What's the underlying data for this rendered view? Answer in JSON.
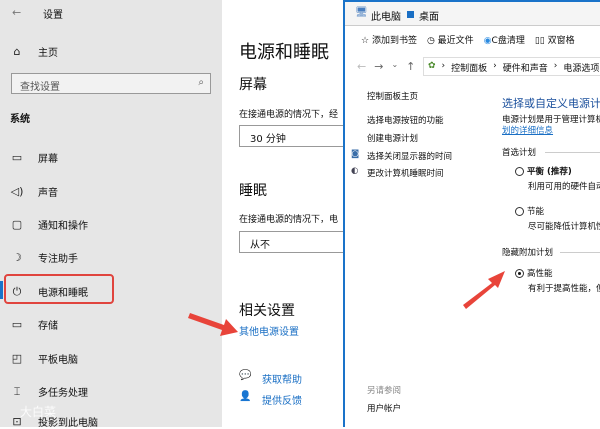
{
  "settings": {
    "title": "设置",
    "home": "主页",
    "search_placeholder": "查找设置",
    "section": "系统",
    "nav": [
      {
        "label": "屏幕",
        "icon": "monitor-icon"
      },
      {
        "label": "声音",
        "icon": "speaker-icon"
      },
      {
        "label": "通知和操作",
        "icon": "notification-icon"
      },
      {
        "label": "专注助手",
        "icon": "moon-icon"
      },
      {
        "label": "电源和睡眠",
        "icon": "power-icon"
      },
      {
        "label": "存储",
        "icon": "storage-icon"
      },
      {
        "label": "平板电脑",
        "icon": "tablet-icon"
      },
      {
        "label": "多任务处理",
        "icon": "multitask-icon"
      },
      {
        "label": "投影到此电脑",
        "icon": "project-icon"
      }
    ],
    "watermark": "大白菜"
  },
  "power": {
    "title": "电源和睡眠",
    "screen_heading": "屏幕",
    "screen_desc": "在接通电源的情况下，经",
    "screen_value": "30 分钟",
    "sleep_heading": "睡眠",
    "sleep_desc": "在接通电源的情况下，电",
    "sleep_value": "从不",
    "related_heading": "相关设置",
    "related_link": "其他电源设置",
    "help": "获取帮助",
    "feedback": "提供反馈"
  },
  "explorer": {
    "tabs": [
      "此电脑",
      "桌面"
    ],
    "bookmarks": [
      "添加到书签",
      "最近文件",
      "C盘清理",
      "双窗格"
    ],
    "breadcrumb": [
      "控制面板",
      "硬件和声音",
      "电源选项"
    ],
    "left_links": [
      "控制面板主页",
      "选择电源按钮的功能",
      "创建电源计划",
      "选择关闭显示器的时间",
      "更改计算机睡眠时间"
    ],
    "see_also": "另请参阅",
    "user_accounts": "用户帐户",
    "heading": "选择或自定义电源计",
    "desc": "电源计划是用于管理计算机",
    "desc_link": "划的详细信息",
    "preferred": "首选计划",
    "hidden": "隐藏附加计划",
    "plans": [
      {
        "name": "平衡 (推荐)",
        "desc": "利用可用的硬件自动",
        "selected": false
      },
      {
        "name": "节能",
        "desc": "尽可能降低计算机性",
        "selected": false
      },
      {
        "name": "高性能",
        "desc": "有利于提高性能，但",
        "selected": true
      }
    ]
  },
  "colors": {
    "accent": "#1a73c9",
    "highlight": "#e0443e"
  }
}
